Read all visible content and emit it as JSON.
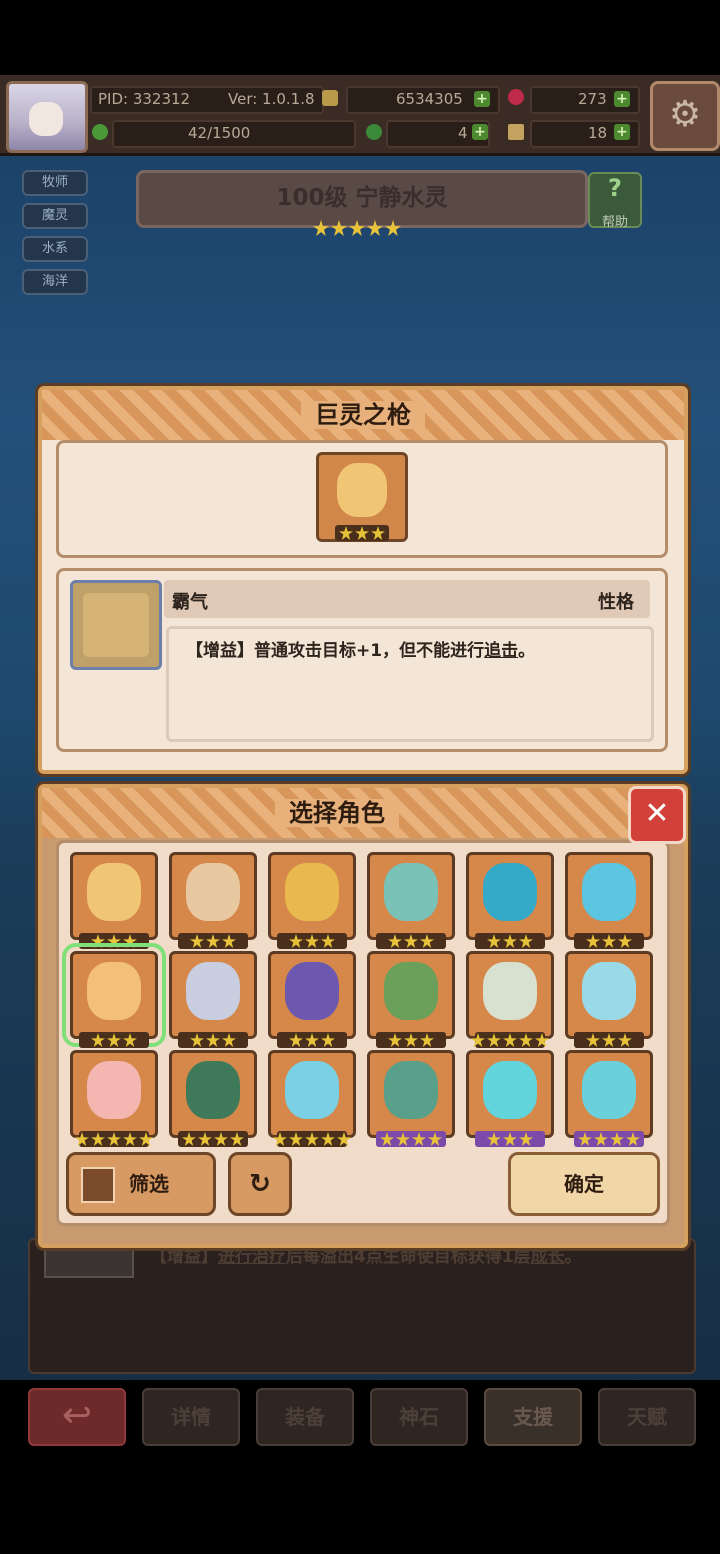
{
  "topbar": {
    "pid": "PID: 332312",
    "version": "Ver: 1.0.1.8",
    "gold": "6534305",
    "gems": "273",
    "stamina": "42/1500",
    "clover": "4",
    "tickets": "18"
  },
  "tags": [
    "牧师",
    "魔灵",
    "水系",
    "海洋"
  ],
  "hero": {
    "name": "100级  宁静水灵",
    "stars": 5
  },
  "help": {
    "label": "帮助",
    "glyph": "?"
  },
  "weapon_dialog": {
    "title": "巨灵之枪",
    "trait": {
      "name": "霸气",
      "type": "性格",
      "desc_prefix": "【增益】普通攻击目标+1，但不能进行",
      "desc_link": "追击",
      "desc_suffix": "。"
    }
  },
  "select_dialog": {
    "title": "选择角色",
    "close": "✕",
    "characters": [
      {
        "stars": 3,
        "bg": "#d5884a",
        "face": "#f0c674"
      },
      {
        "stars": 3,
        "bg": "#d5884a",
        "face": "#e8c8a0"
      },
      {
        "stars": 3,
        "bg": "#d5884a",
        "face": "#e9b84e"
      },
      {
        "stars": 3,
        "bg": "#d5884a",
        "face": "#7ac2b8"
      },
      {
        "stars": 3,
        "bg": "#d5884a",
        "face": "#34a9c8"
      },
      {
        "stars": 3,
        "bg": "#d5884a",
        "face": "#5cc6e0"
      },
      {
        "stars": 3,
        "bg": "#d5884a",
        "face": "#f2c07a",
        "selected": true
      },
      {
        "stars": 3,
        "bg": "#d5884a",
        "face": "#c8cde0"
      },
      {
        "stars": 3,
        "bg": "#d5884a",
        "face": "#6d58b0"
      },
      {
        "stars": 3,
        "bg": "#d5884a",
        "face": "#6aa05a"
      },
      {
        "stars": 5,
        "bg": "#d5884a",
        "face": "#d8e0cf"
      },
      {
        "stars": 3,
        "bg": "#d5884a",
        "face": "#9ad9e8"
      },
      {
        "stars": 5,
        "bg": "#d5884a",
        "face": "#f4b6b0"
      },
      {
        "stars": 4,
        "bg": "#d5884a",
        "face": "#3e7a5a"
      },
      {
        "stars": 5,
        "bg": "#d5884a",
        "face": "#7cd0e6"
      },
      {
        "stars": 4,
        "bg": "#d5884a",
        "face": "#58a08a",
        "purple": true
      },
      {
        "stars": 3,
        "bg": "#d5884a",
        "face": "#62d4dc",
        "purple": true
      },
      {
        "stars": 4,
        "bg": "#d5884a",
        "face": "#6ad0dc",
        "purple": true
      }
    ],
    "filter_label": "筛选",
    "refresh_glyph": "↻",
    "confirm_label": "确定"
  },
  "under_panel": {
    "text_prefix": "【增益】",
    "link1": "进行治疗",
    "text_mid": "后每溢出4点生命使目标获得1层",
    "link2": "成长",
    "text_suffix": "。"
  },
  "nav": {
    "back_glyph": "↩",
    "items": [
      "详情",
      "装备",
      "神石",
      "支援",
      "天赋"
    ]
  },
  "icons": [
    "portrait-avatar-icon",
    "gold-coin-icon",
    "gem-icon",
    "clover-icon",
    "ticket-icon",
    "gear-icon",
    "question-icon",
    "grid-filter-icon",
    "refresh-icon",
    "close-icon",
    "back-arrow-icon"
  ]
}
